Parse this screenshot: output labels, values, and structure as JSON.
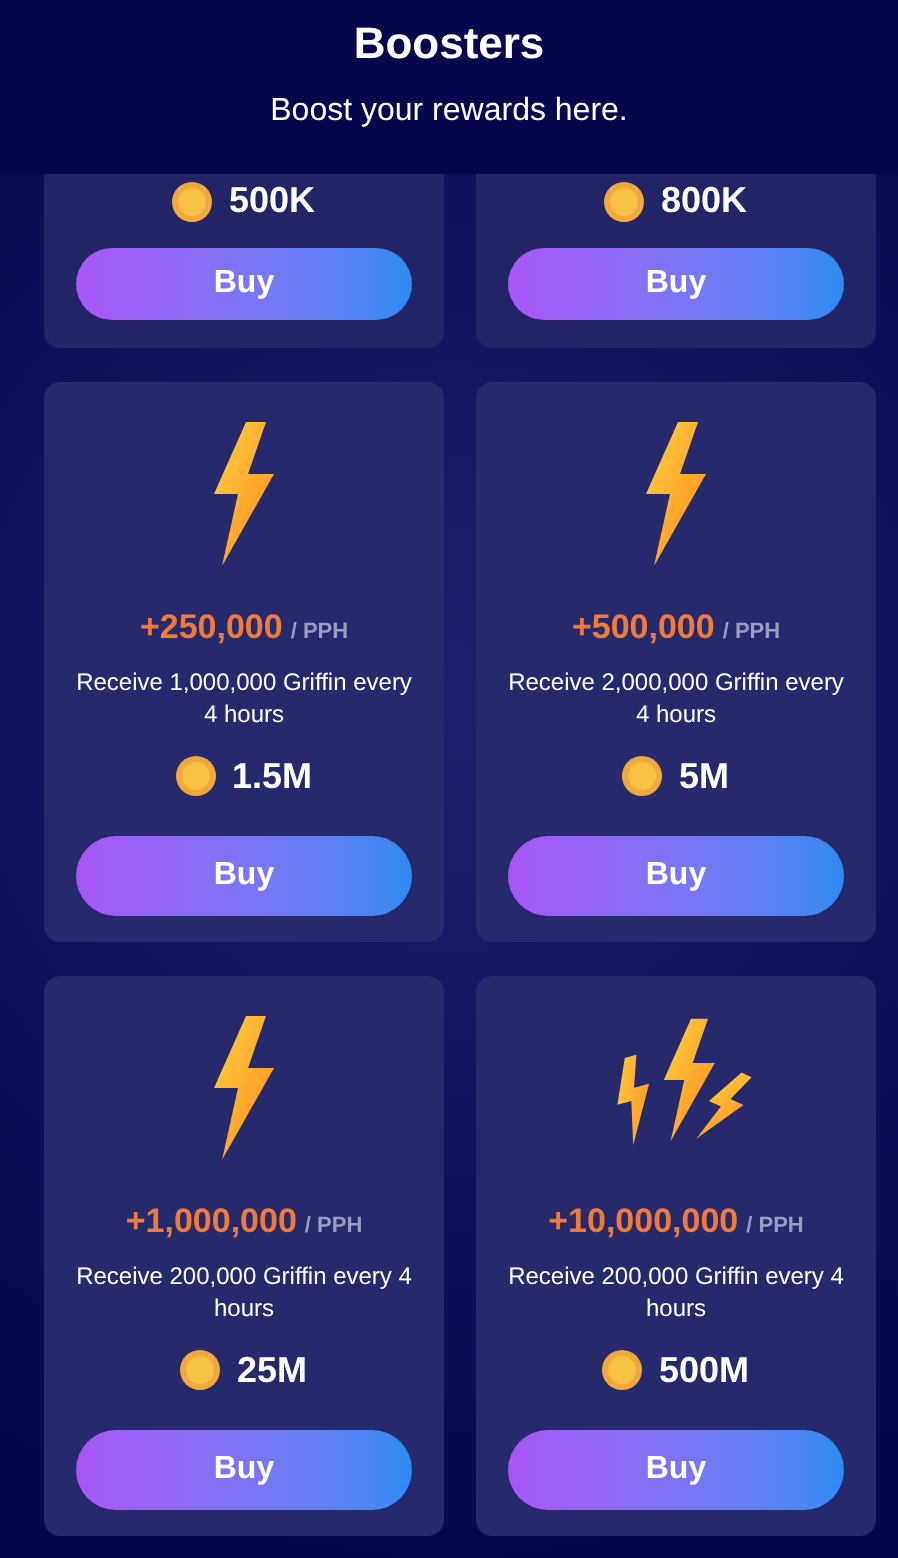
{
  "header": {
    "title": "Boosters",
    "subtitle": "Boost your rewards here."
  },
  "partial_cards": [
    {
      "price": "500K",
      "button": "Buy"
    },
    {
      "price": "800K",
      "button": "Buy"
    }
  ],
  "cards": [
    {
      "kind": "single",
      "bonus": "+250,000",
      "unit": "/ PPH",
      "description": "Receive 1,000,000 Griffin every 4 hours",
      "price": "1.5M",
      "button": "Buy"
    },
    {
      "kind": "single",
      "bonus": "+500,000",
      "unit": "/ PPH",
      "description": "Receive 2,000,000 Griffin every 4 hours",
      "price": "5M",
      "button": "Buy"
    },
    {
      "kind": "single",
      "bonus": "+1,000,000",
      "unit": "/ PPH",
      "description": "Receive 200,000 Griffin every 4 hours",
      "price": "25M",
      "button": "Buy"
    },
    {
      "kind": "triple",
      "bonus": "+10,000,000",
      "unit": "/ PPH",
      "description": "Receive 200,000 Griffin every 4 hours",
      "price": "500M",
      "button": "Buy"
    }
  ]
}
